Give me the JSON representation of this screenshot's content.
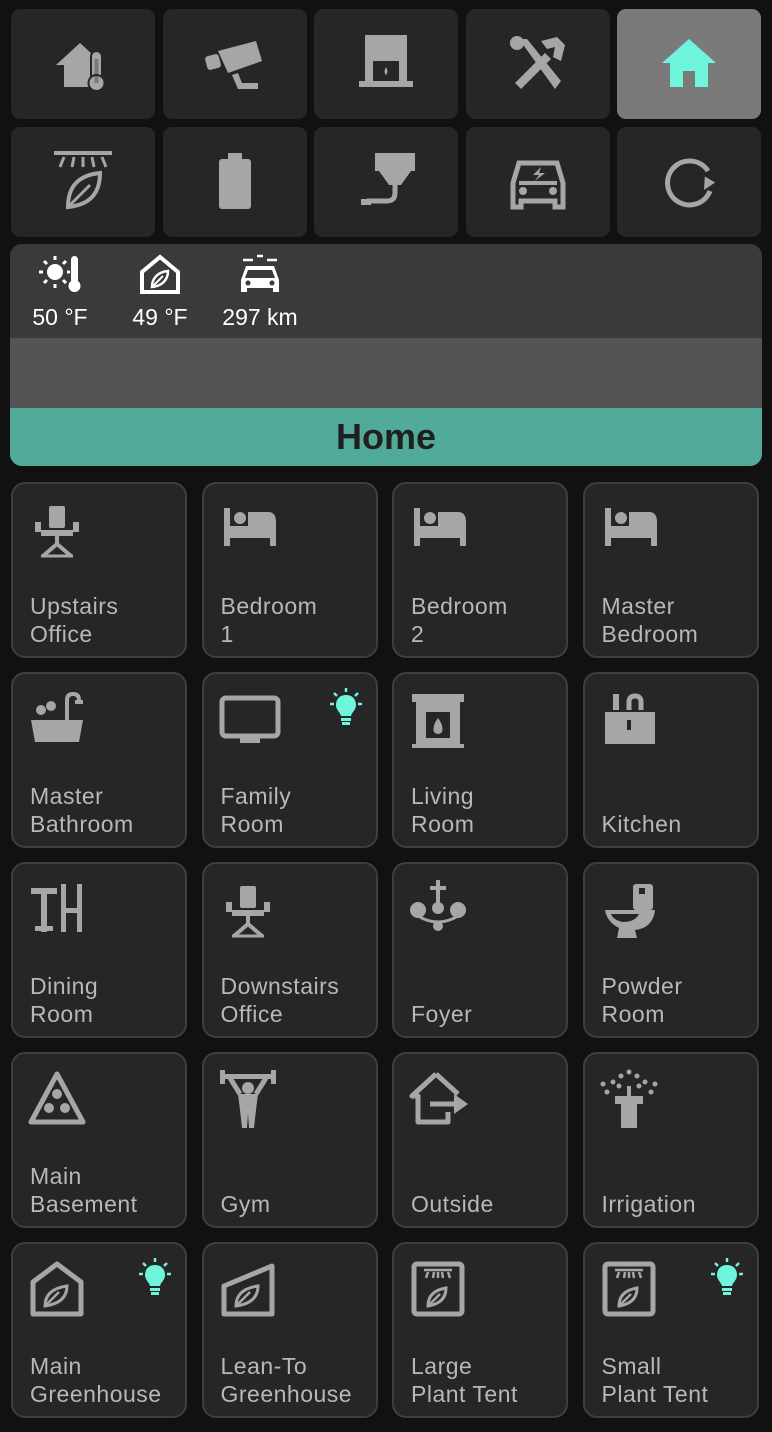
{
  "nav": {
    "buttons": [
      {
        "icon": "home-thermometer-icon"
      },
      {
        "icon": "cctv-icon"
      },
      {
        "icon": "water-heater-icon"
      },
      {
        "icon": "tools-icon"
      },
      {
        "icon": "home-icon",
        "active": true
      },
      {
        "icon": "grow-light-leaf-icon"
      },
      {
        "icon": "battery-icon"
      },
      {
        "icon": "water-pump-icon"
      },
      {
        "icon": "ev-car-icon"
      },
      {
        "icon": "refresh-icon"
      }
    ]
  },
  "status": {
    "outdoor_temp": "50 °F",
    "greenhouse_temp": "49 °F",
    "car_range": "297 km"
  },
  "page_title": "Home",
  "rooms": [
    {
      "l1": "Upstairs",
      "l2": "Office",
      "icon": "office-chair-icon"
    },
    {
      "l1": "Bedroom",
      "l2": "1",
      "icon": "bed-icon"
    },
    {
      "l1": "Bedroom",
      "l2": "2",
      "icon": "bed-icon"
    },
    {
      "l1": "Master",
      "l2": "Bedroom",
      "icon": "bed-icon"
    },
    {
      "l1": "Master",
      "l2": "Bathroom",
      "icon": "bathtub-icon"
    },
    {
      "l1": "Family",
      "l2": "Room",
      "icon": "television-icon",
      "light_on": true
    },
    {
      "l1": "Living",
      "l2": "Room",
      "icon": "fireplace-icon"
    },
    {
      "l1": "",
      "l2": "Kitchen",
      "icon": "kitchen-icon"
    },
    {
      "l1": "Dining",
      "l2": "Room",
      "icon": "dining-table-icon"
    },
    {
      "l1": "Downstairs",
      "l2": "Office",
      "icon": "office-chair-icon"
    },
    {
      "l1": "",
      "l2": "Foyer",
      "icon": "chandelier-icon"
    },
    {
      "l1": "Powder",
      "l2": "Room",
      "icon": "toilet-icon"
    },
    {
      "l1": "Main",
      "l2": "Basement",
      "icon": "billiards-rack-icon"
    },
    {
      "l1": "",
      "l2": "Gym",
      "icon": "weight-lifter-icon"
    },
    {
      "l1": "",
      "l2": "Outside",
      "icon": "home-export-icon"
    },
    {
      "l1": "",
      "l2": "Irrigation",
      "icon": "sprinkler-icon"
    },
    {
      "l1": "Main",
      "l2": "Greenhouse",
      "icon": "greenhouse-icon",
      "light_on": true
    },
    {
      "l1": "Lean-To",
      "l2": "Greenhouse",
      "icon": "lean-to-greenhouse-icon"
    },
    {
      "l1": "Large",
      "l2": "Plant Tent",
      "icon": "grow-tent-icon"
    },
    {
      "l1": "Small",
      "l2": "Plant Tent",
      "icon": "grow-tent-icon",
      "light_on": true
    }
  ],
  "colors": {
    "accent": "#6ef5dc",
    "title_bar": "#52ab9a",
    "icon": "#a6a6a6",
    "tile_bg": "#262626",
    "page_bg": "#111111"
  }
}
